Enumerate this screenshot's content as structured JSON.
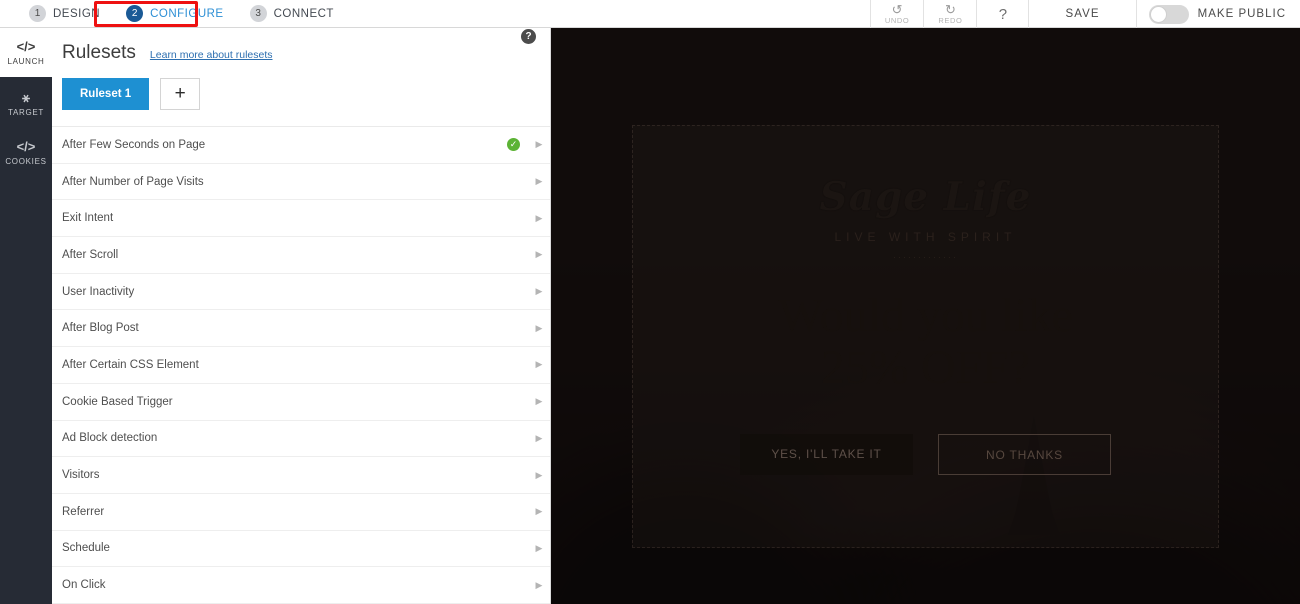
{
  "topbar": {
    "steps": [
      {
        "num": "1",
        "label": "DESIGN",
        "active": false
      },
      {
        "num": "2",
        "label": "CONFIGURE",
        "active": true
      },
      {
        "num": "3",
        "label": "CONNECT",
        "active": false
      }
    ],
    "undo": {
      "icon": "undo-icon",
      "glyph": "↺",
      "label": "UNDO"
    },
    "redo": {
      "icon": "redo-icon",
      "glyph": "↻",
      "label": "REDO"
    },
    "help": {
      "icon": "question-mark-icon",
      "glyph": "?"
    },
    "save_label": "SAVE",
    "make_public_label": "MAKE PUBLIC",
    "make_public_state": "off",
    "annotation_color": "#ee1111",
    "accent_blue": "#2d8fd5"
  },
  "rail": {
    "items": [
      {
        "glyph": "</>",
        "label": "LAUNCH",
        "icon": "code-icon",
        "active": true
      },
      {
        "glyph": "⚹",
        "label": "TARGET",
        "icon": "person-icon",
        "active": false
      },
      {
        "glyph": "</>",
        "label": "COOKIES",
        "icon": "code-icon",
        "active": false
      }
    ]
  },
  "panel": {
    "title": "Rulesets",
    "link": "Learn more about rulesets",
    "help_glyph": "?",
    "tabs": [
      {
        "label": "Ruleset 1",
        "active": true
      }
    ],
    "add_tab_glyph": "+",
    "tab_color": "#1e90d2",
    "rules": [
      {
        "name": "After Few Seconds on Page",
        "enabled": true
      },
      {
        "name": "After Number of Page Visits",
        "enabled": false
      },
      {
        "name": "Exit Intent",
        "enabled": false
      },
      {
        "name": "After Scroll",
        "enabled": false
      },
      {
        "name": "User Inactivity",
        "enabled": false
      },
      {
        "name": "After Blog Post",
        "enabled": false
      },
      {
        "name": "After Certain CSS Element",
        "enabled": false
      },
      {
        "name": "Cookie Based Trigger",
        "enabled": false
      },
      {
        "name": "Ad Block detection",
        "enabled": false
      },
      {
        "name": "Visitors",
        "enabled": false
      },
      {
        "name": "Referrer",
        "enabled": false
      },
      {
        "name": "Schedule",
        "enabled": false
      },
      {
        "name": "On Click",
        "enabled": false
      }
    ],
    "check_glyph": "✓",
    "chevron_glyph": "▶",
    "check_color": "#5cb335"
  },
  "preview": {
    "brand": "Sage Life",
    "brand_sub": "LIVE WITH SPIRIT",
    "brand_dots": "·············",
    "headline_line1": "Would you like",
    "headline_line2": "25% OFF?",
    "cta_primary": "YES, I'LL TAKE IT",
    "cta_secondary": "NO THANKS"
  }
}
